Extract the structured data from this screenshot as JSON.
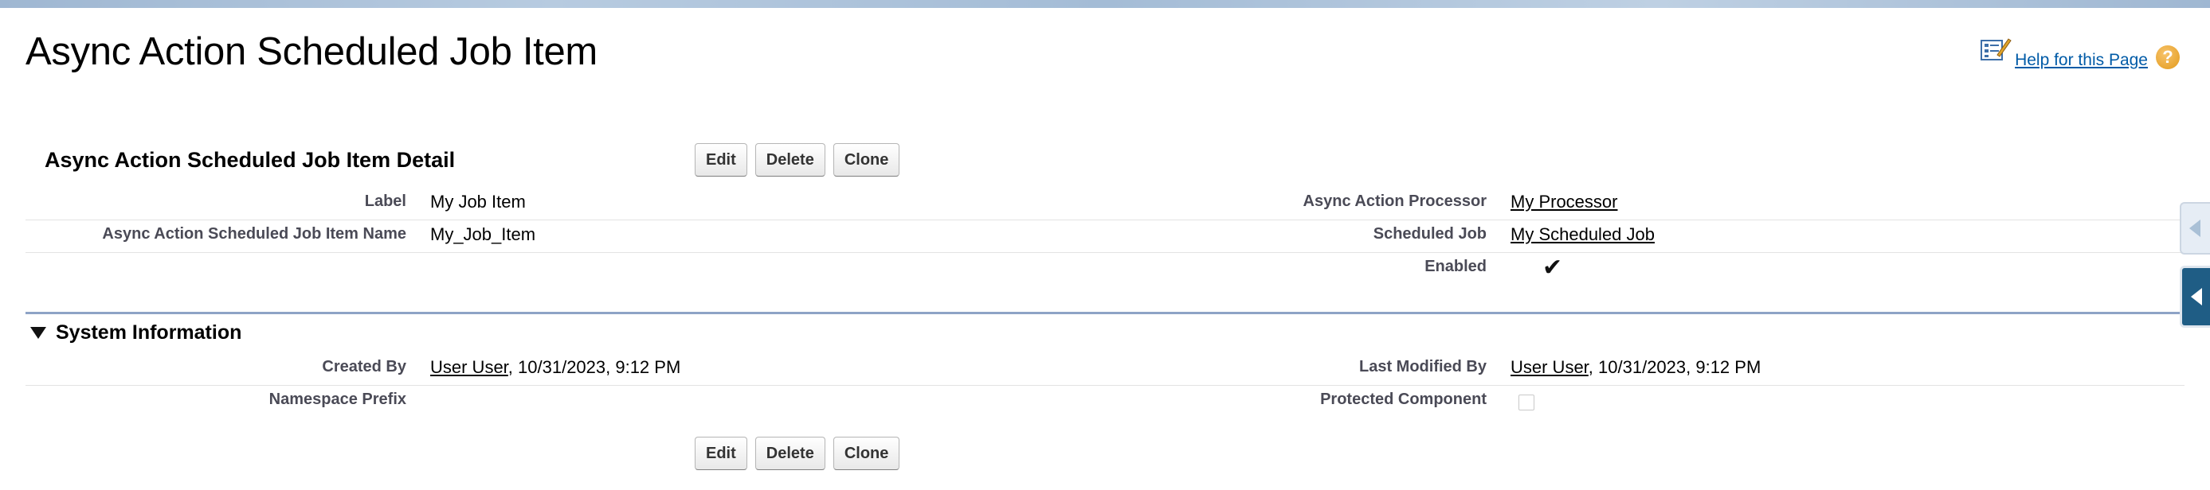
{
  "header": {
    "title": "Async Action Scheduled Job Item",
    "help_link": "Help for this Page",
    "help_icon": "question-icon"
  },
  "detail": {
    "section_title": "Async Action Scheduled Job Item Detail",
    "buttons": {
      "edit": "Edit",
      "delete": "Delete",
      "clone": "Clone"
    },
    "fields": {
      "label_label": "Label",
      "label_value": "My Job Item",
      "name_label": "Async Action Scheduled Job Item Name",
      "name_value": "My_Job_Item",
      "processor_label": "Async Action Processor",
      "processor_value": "My Processor",
      "scheduled_job_label": "Scheduled Job",
      "scheduled_job_value": "My Scheduled Job",
      "enabled_label": "Enabled",
      "enabled_value": true
    }
  },
  "system_info": {
    "title": "System Information",
    "created_by_label": "Created By",
    "created_by_user": "User User",
    "created_by_date": ", 10/31/2023, 9:12 PM",
    "last_modified_label": "Last Modified By",
    "last_modified_user": "User User",
    "last_modified_date": ", 10/31/2023, 9:12 PM",
    "namespace_label": "Namespace Prefix",
    "namespace_value": "",
    "protected_label": "Protected Component",
    "protected_value": false
  },
  "colors": {
    "link_blue": "#015ba7",
    "rule_blue": "#8ea3c6",
    "label_gray": "#4a4a56",
    "side_tab_blue": "#1f5d85"
  }
}
